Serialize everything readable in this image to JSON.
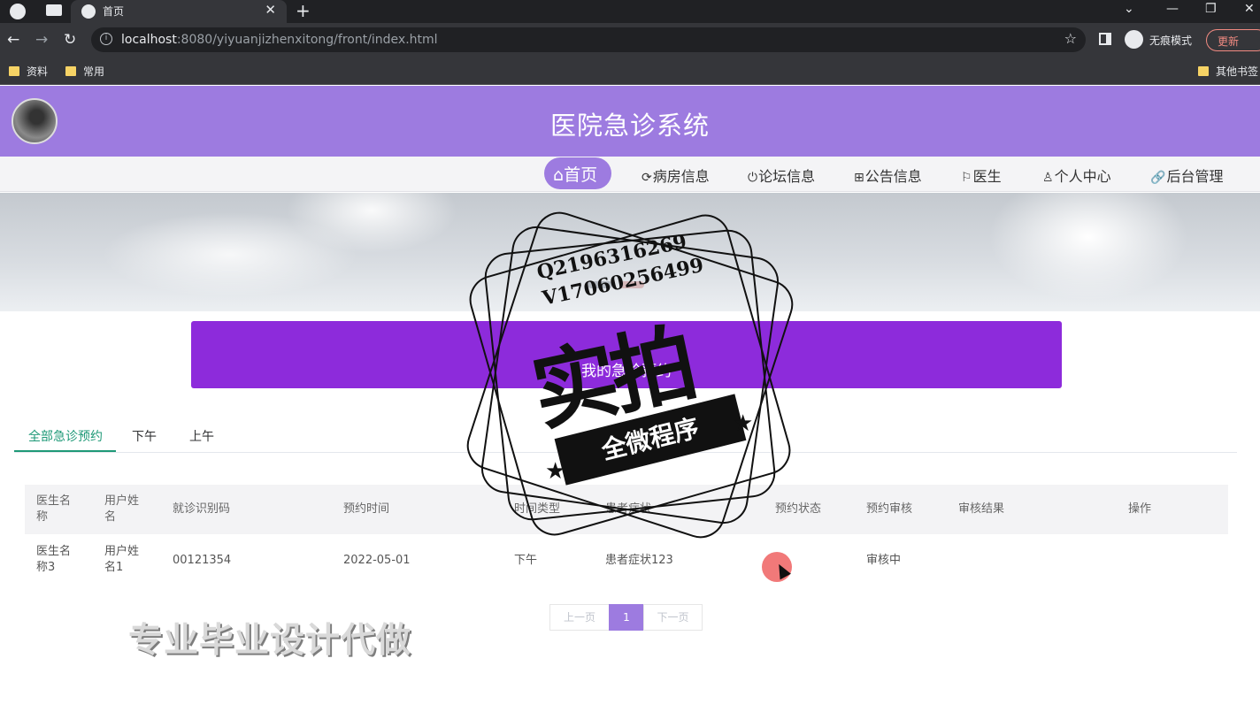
{
  "browser": {
    "tab_title": "首页",
    "url_host": "localhost",
    "url_rest": ":8080/yiyuanjizhenxitong/front/index.html",
    "incognito_label": "无痕模式",
    "update_label": "更新",
    "bookmarks": [
      "资料",
      "常用"
    ],
    "other_bookmarks": "其他书签"
  },
  "header": {
    "title": "医院急诊系统"
  },
  "nav": {
    "items": [
      {
        "label": "首页",
        "icon": "home-icon"
      },
      {
        "label": "病房信息",
        "icon": "refresh-icon"
      },
      {
        "label": "论坛信息",
        "icon": "power-icon"
      },
      {
        "label": "公告信息",
        "icon": "grid-icon"
      },
      {
        "label": "医生",
        "icon": "flag-icon"
      },
      {
        "label": "个人中心",
        "icon": "user-icon"
      },
      {
        "label": "后台管理",
        "icon": "link-icon"
      }
    ]
  },
  "section": {
    "title_line1": "",
    "title_line2": "我的急诊预约"
  },
  "tabs": [
    "全部急诊预约",
    "下午",
    "上午"
  ],
  "table": {
    "headers": [
      "医生名称",
      "用户姓名",
      "就诊识别码",
      "预约时间",
      "时间类型",
      "患者症状",
      "预约状态",
      "预约审核",
      "审核结果",
      "操作"
    ],
    "rows": [
      [
        "医生名称3",
        "用户姓名1",
        "00121354",
        "2022-05-01",
        "下午",
        "患者症状123",
        "",
        "审核中",
        "",
        ""
      ]
    ]
  },
  "pagination": {
    "prev": "上一页",
    "current": "1",
    "next": "下一页"
  },
  "overlay": {
    "watermark": "专业毕业设计代做",
    "stamp_contact1": "Q2196316269",
    "stamp_contact2": "V17060256499",
    "stamp_big": "实拍",
    "stamp_ribbon": "全微程序"
  },
  "colors": {
    "header": "#9d7be0",
    "section_bar": "#8d2bdb",
    "tab_active": "#1e9977"
  }
}
